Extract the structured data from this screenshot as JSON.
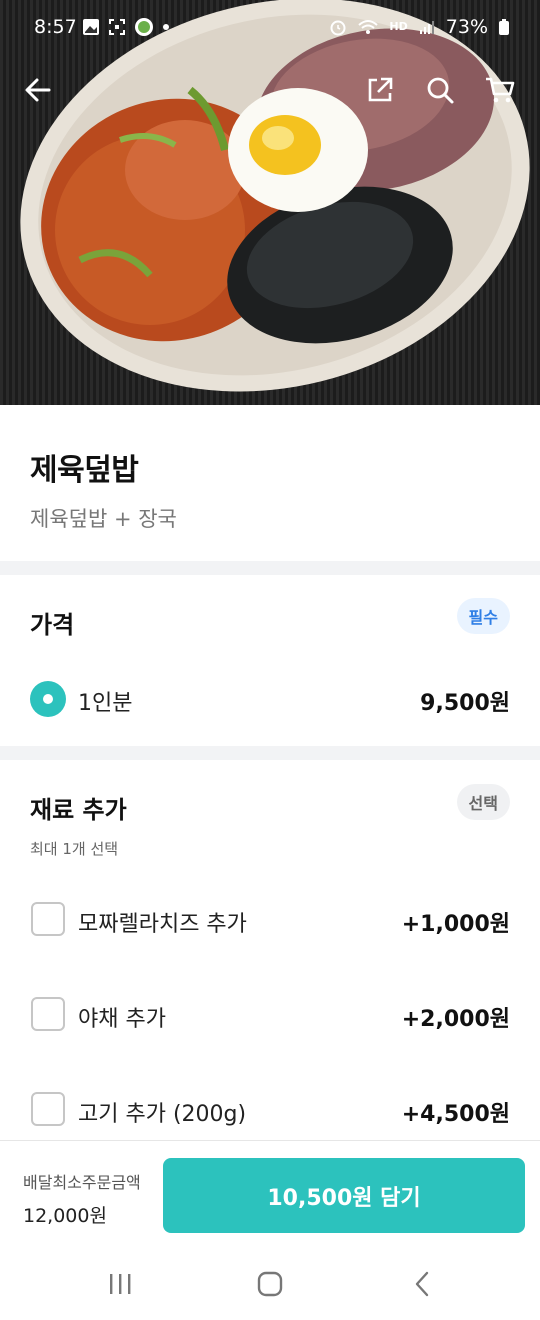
{
  "status_bar": {
    "time": "8:57",
    "battery": "73%",
    "hd_label": "HD"
  },
  "top_actions": {
    "back_icon": "back-arrow-icon",
    "share_icon": "share-icon",
    "search_icon": "search-icon",
    "cart_icon": "cart-icon"
  },
  "menu": {
    "name": "제육덮밥",
    "description": "제육덮밥 + 장국"
  },
  "price_section": {
    "title": "가격",
    "badge": "필수",
    "options": [
      {
        "label": "1인분",
        "price": "9,500원",
        "selected": true
      }
    ]
  },
  "add_section": {
    "title": "재료 추가",
    "badge": "선택",
    "note": "최대 1개 선택",
    "options": [
      {
        "label": "모짜렐라치즈 추가",
        "price": "+1,000원",
        "checked": false
      },
      {
        "label": "야채 추가",
        "price": "+2,000원",
        "checked": false
      },
      {
        "label": "고기 추가 (200g)",
        "price": "+4,500원",
        "checked": false
      }
    ]
  },
  "bottom_bar": {
    "min_order_label": "배달최소주문금액",
    "min_order_value": "12,000원",
    "cart_button": "10,500원 담기"
  },
  "colors": {
    "accent": "#2cc2bd",
    "required_badge": "#2f7fe6",
    "divider": "#f2f3f5"
  }
}
